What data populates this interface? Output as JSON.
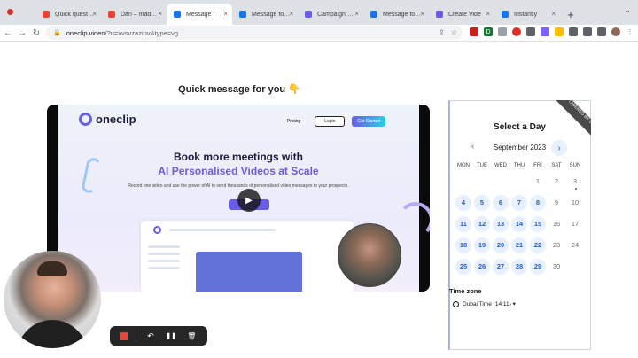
{
  "browser": {
    "tabs": [
      {
        "label": "Quick question",
        "color": "#ea4335"
      },
      {
        "label": "Dan – made this",
        "color": "#ea4335"
      },
      {
        "label": "Message f",
        "color": "#1a73e8",
        "active": true
      },
      {
        "label": "Message for yo",
        "color": "#1a73e8"
      },
      {
        "label": "Campaign Det",
        "color": "#6b5ce7"
      },
      {
        "label": "Message for yo",
        "color": "#1a73e8"
      },
      {
        "label": "Create Vide",
        "color": "#6b5ce7"
      },
      {
        "label": "Instantly",
        "color": "#1a73e8"
      }
    ],
    "new_tab": "+",
    "window_control": "⌄",
    "url_host": "oneclip.video",
    "url_rest": "/?u=xvsvzazipv&type=vg"
  },
  "page": {
    "heading": "Quick message for you 👇"
  },
  "video": {
    "logo": "oneclip",
    "nav_pricing": "Pricing",
    "nav_login": "Login",
    "nav_start": "Get Started",
    "hero_line1": "Book more meetings with",
    "hero_line2": "AI Personalised Videos at Scale",
    "hero_sub": "Record one video and use the power of AI to send thousands of personalised video messages to your prospects.",
    "play_icon": "▶"
  },
  "calendar": {
    "ribbon": "POWERED BY Calendly",
    "title": "Select a Day",
    "month": "September 2023",
    "prev": "‹",
    "next": "›",
    "weekdays": [
      "MON",
      "TUE",
      "WED",
      "THU",
      "FRI",
      "SAT",
      "SUN"
    ],
    "days": [
      {
        "d": "1",
        "c": 4,
        "r": 0,
        "a": false
      },
      {
        "d": "2",
        "c": 5,
        "r": 0,
        "a": false
      },
      {
        "d": "3",
        "c": 6,
        "r": 0,
        "a": false,
        "today": true
      },
      {
        "d": "4",
        "c": 0,
        "r": 1,
        "a": true
      },
      {
        "d": "5",
        "c": 1,
        "r": 1,
        "a": true
      },
      {
        "d": "6",
        "c": 2,
        "r": 1,
        "a": true
      },
      {
        "d": "7",
        "c": 3,
        "r": 1,
        "a": true
      },
      {
        "d": "8",
        "c": 4,
        "r": 1,
        "a": true
      },
      {
        "d": "9",
        "c": 5,
        "r": 1,
        "a": false
      },
      {
        "d": "10",
        "c": 6,
        "r": 1,
        "a": false
      },
      {
        "d": "11",
        "c": 0,
        "r": 2,
        "a": true
      },
      {
        "d": "12",
        "c": 1,
        "r": 2,
        "a": true
      },
      {
        "d": "13",
        "c": 2,
        "r": 2,
        "a": true
      },
      {
        "d": "14",
        "c": 3,
        "r": 2,
        "a": true
      },
      {
        "d": "15",
        "c": 4,
        "r": 2,
        "a": true
      },
      {
        "d": "16",
        "c": 5,
        "r": 2,
        "a": false
      },
      {
        "d": "17",
        "c": 6,
        "r": 2,
        "a": false
      },
      {
        "d": "18",
        "c": 0,
        "r": 3,
        "a": true
      },
      {
        "d": "19",
        "c": 1,
        "r": 3,
        "a": true
      },
      {
        "d": "20",
        "c": 2,
        "r": 3,
        "a": true
      },
      {
        "d": "21",
        "c": 3,
        "r": 3,
        "a": true
      },
      {
        "d": "22",
        "c": 4,
        "r": 3,
        "a": true
      },
      {
        "d": "23",
        "c": 5,
        "r": 3,
        "a": false
      },
      {
        "d": "24",
        "c": 6,
        "r": 3,
        "a": false
      },
      {
        "d": "25",
        "c": 0,
        "r": 4,
        "a": true
      },
      {
        "d": "26",
        "c": 1,
        "r": 4,
        "a": true
      },
      {
        "d": "27",
        "c": 2,
        "r": 4,
        "a": true
      },
      {
        "d": "28",
        "c": 3,
        "r": 4,
        "a": true
      },
      {
        "d": "29",
        "c": 4,
        "r": 4,
        "a": true
      },
      {
        "d": "30",
        "c": 5,
        "r": 4,
        "a": false
      }
    ],
    "timezone_label": "Time zone",
    "timezone_value": "Dubai Time (14:11) ▾"
  },
  "recorder": {
    "undo_icon": "↶",
    "pause_icon": "❚❚",
    "delete_icon": "🗑"
  }
}
